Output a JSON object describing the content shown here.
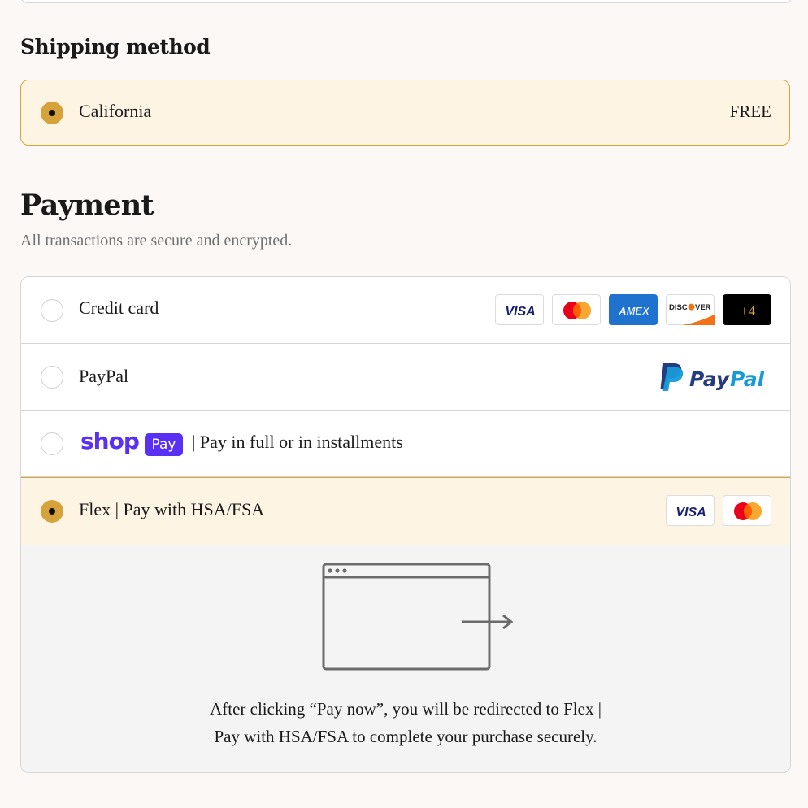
{
  "shipping": {
    "title": "Shipping method",
    "option_name": "California",
    "option_price": "FREE"
  },
  "payment": {
    "title": "Payment",
    "subtitle": "All transactions are secure and encrypted.",
    "methods": [
      {
        "label": "Credit card",
        "selected": false,
        "cards": [
          "VISA",
          "MASTERCARD",
          "AMEX",
          "DISCOVER",
          "+4"
        ]
      },
      {
        "label": "PayPal",
        "selected": false,
        "brand": "PayPal"
      },
      {
        "label": "| Pay in full or in installments",
        "selected": false,
        "brand_text": "shop",
        "brand_badge": "Pay"
      },
      {
        "label": "Flex | Pay with HSA/FSA",
        "selected": true,
        "cards": [
          "VISA",
          "MASTERCARD"
        ]
      }
    ],
    "redirect_message_line1": "After clicking “Pay now”, you will be redirected to Flex |",
    "redirect_message_line2": "Pay with HSA/FSA to complete your purchase securely."
  },
  "colors": {
    "accent_gold": "#d6a23b",
    "selected_bg": "#fdf4e4",
    "shop_purple": "#5a31f4",
    "paypal_dark": "#253b80",
    "paypal_light": "#179bd7"
  },
  "icons": {
    "redirect": "browser-window-arrow-icon"
  }
}
